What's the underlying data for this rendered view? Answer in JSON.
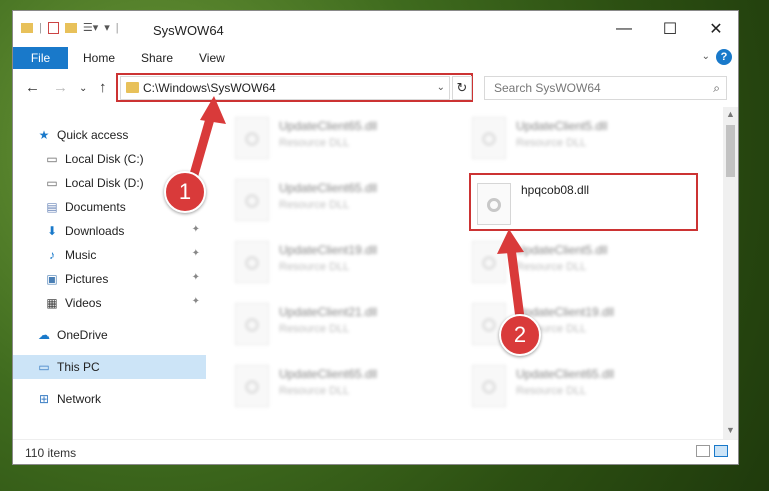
{
  "window": {
    "title": "SysWOW64",
    "controls": {
      "minimize": "—",
      "maximize": "☐",
      "close": "✕"
    }
  },
  "ribbon": {
    "tabs": [
      "File",
      "Home",
      "Share",
      "View"
    ],
    "help": "?"
  },
  "address_bar": {
    "path": "C:\\Windows\\SysWOW64",
    "search_placeholder": "Search SysWOW64"
  },
  "nav_pane": {
    "items": [
      {
        "label": "Quick access",
        "icon": "star-icon"
      },
      {
        "label": "Local Disk (C:)",
        "icon": "drive-icon"
      },
      {
        "label": "Local Disk (D:)",
        "icon": "drive-icon"
      },
      {
        "label": "Documents",
        "icon": "documents-icon"
      },
      {
        "label": "Downloads",
        "icon": "download-icon"
      },
      {
        "label": "Music",
        "icon": "music-icon"
      },
      {
        "label": "Pictures",
        "icon": "pictures-icon"
      },
      {
        "label": "Videos",
        "icon": "videos-icon"
      },
      {
        "label": "OneDrive",
        "icon": "cloud-icon"
      },
      {
        "label": "This PC",
        "icon": "computer-icon"
      },
      {
        "label": "Network",
        "icon": "network-icon"
      }
    ]
  },
  "files": [
    {
      "name": "UpdateClient65.dll",
      "type": "Resource DLL"
    },
    {
      "name": "UpdateClient5.dll",
      "type": "Resource DLL"
    },
    {
      "name": "UpdateClient65.dll",
      "type": "Resource DLL"
    },
    {
      "name": "hpqcob08.dll",
      "type": ""
    },
    {
      "name": "UpdateClient19.dll",
      "type": "Resource DLL"
    },
    {
      "name": "UpdateClient5.dll",
      "type": "Resource DLL"
    },
    {
      "name": "UpdateClient21.dll",
      "type": "Resource DLL"
    },
    {
      "name": "UpdateClient19.dll",
      "type": "Resource DLL"
    },
    {
      "name": "UpdateClient65.dll",
      "type": "Resource DLL"
    },
    {
      "name": "UpdateClient65.dll",
      "type": "Resource DLL"
    }
  ],
  "status": {
    "item_count": "110 items"
  },
  "callouts": [
    "1",
    "2"
  ],
  "colors": {
    "accent": "#1979ca",
    "highlight": "#cc3333",
    "selected": "#cce4f7"
  }
}
